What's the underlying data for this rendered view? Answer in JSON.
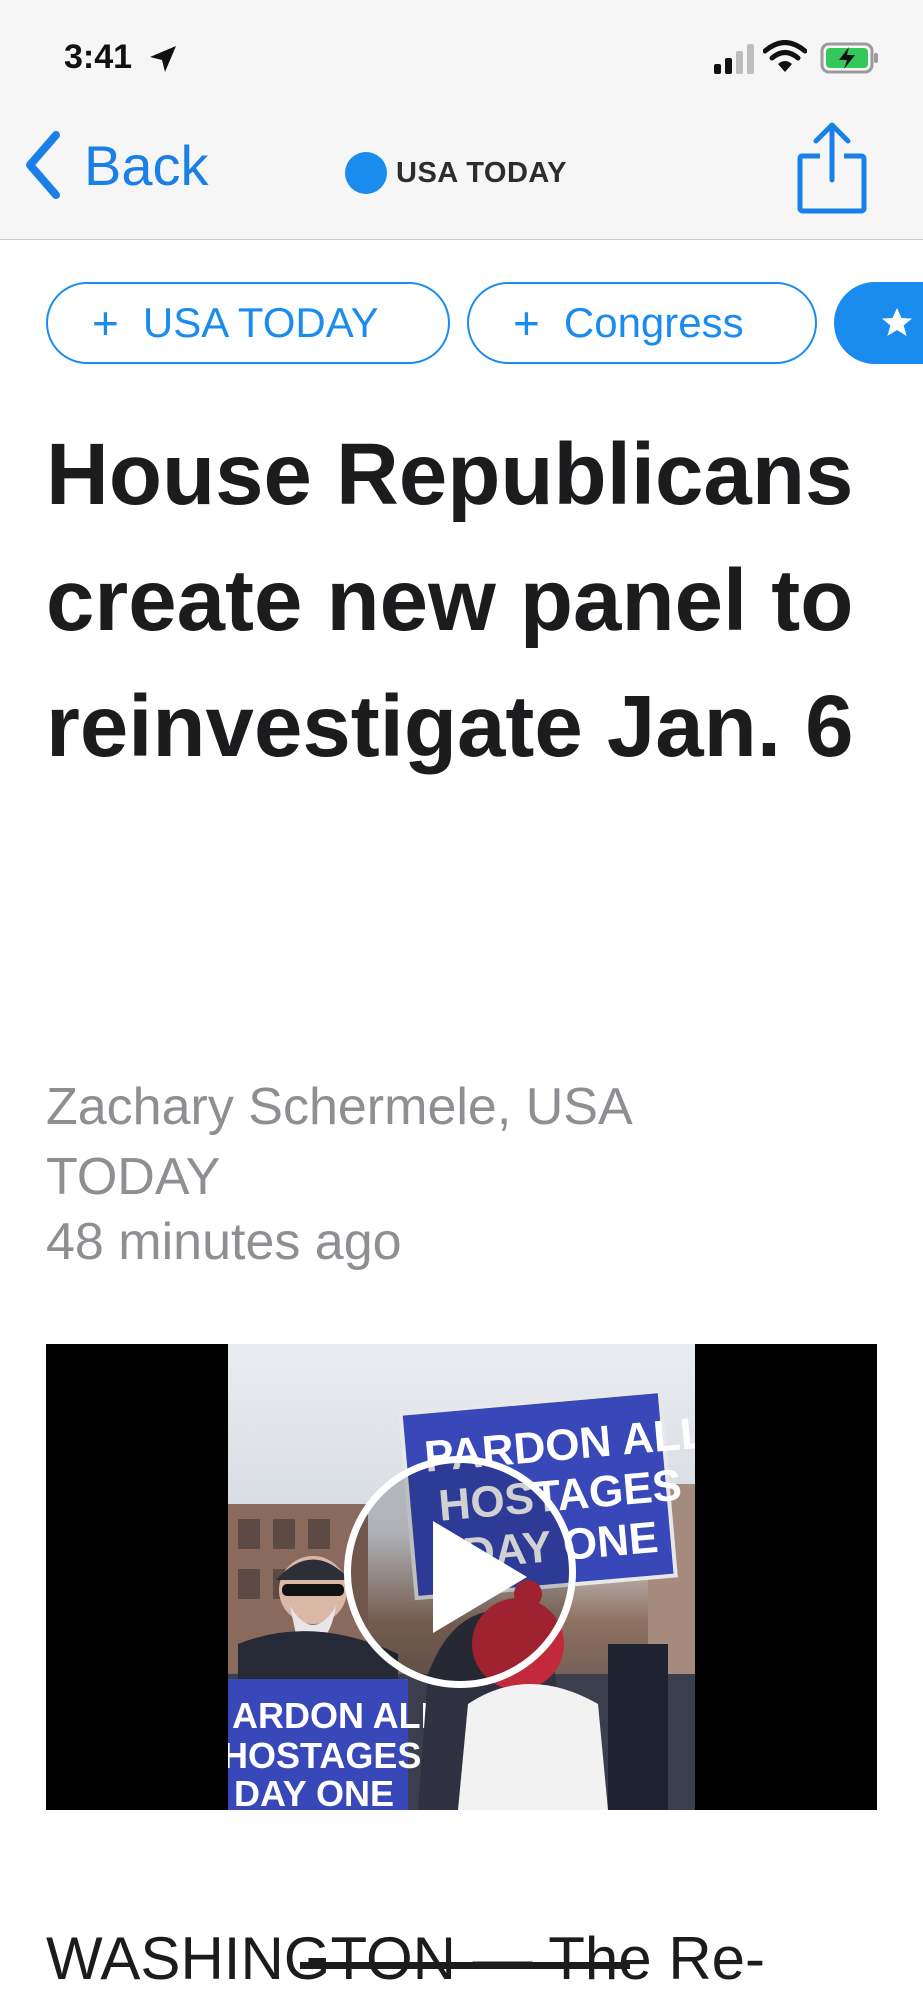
{
  "status_bar": {
    "time": "3:41",
    "icons": [
      "location-arrow-icon",
      "cellular-signal-icon",
      "wifi-icon",
      "battery-charging-icon"
    ]
  },
  "nav": {
    "back_label": "Back",
    "publisher": "USA TODAY",
    "share_icon": "share-icon",
    "accent_color": "#1a7fe6"
  },
  "topics": [
    {
      "label": "USA TODAY",
      "icon": "plus"
    },
    {
      "label": "Congress",
      "icon": "plus"
    },
    {
      "label": "",
      "icon": "star"
    }
  ],
  "article": {
    "headline": "House Republicans create new panel to reinvestigate Jan. 6",
    "byline": "Zachary Schermele, USA TODAY",
    "timestamp": "48 minutes ago",
    "video": {
      "play_icon": "play-icon",
      "sign_lines": [
        "PARDON ALL",
        "HOSTAGES",
        "DAY ONE"
      ]
    },
    "body_start": "WASHINGTON — The Re-"
  }
}
